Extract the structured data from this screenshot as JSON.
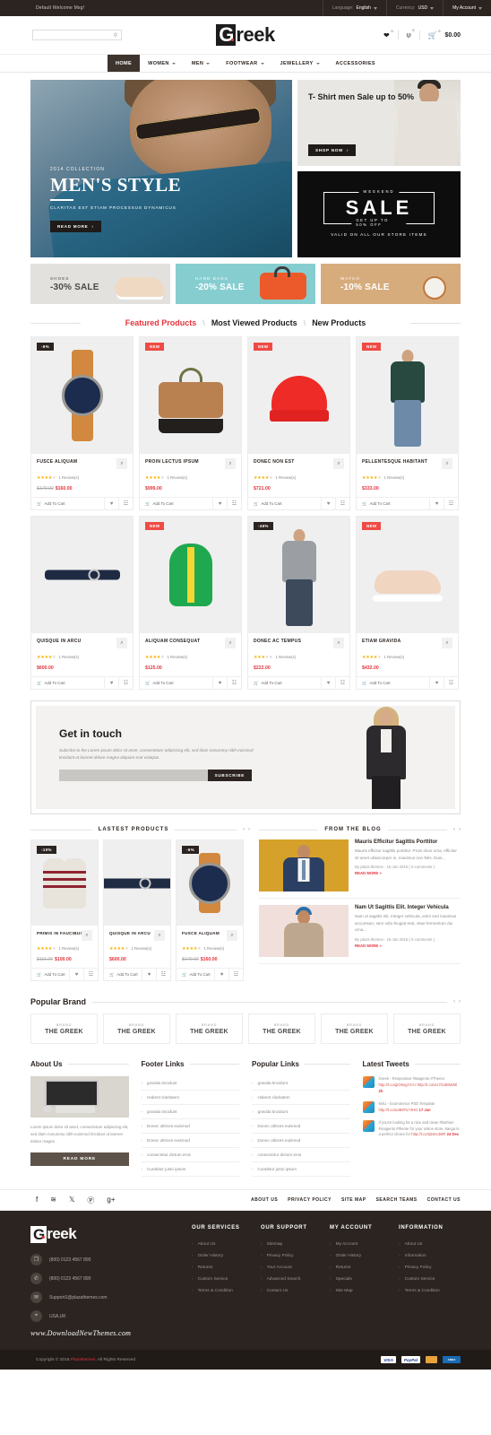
{
  "topbar": {
    "welcome": "Default Welcome Msg!",
    "language_label": "Language:",
    "language_value": "English",
    "currency_label": "Currency:",
    "currency_value": "USD",
    "account": "My Account"
  },
  "header": {
    "search_placeholder": "",
    "logo_first": "G",
    "logo_rest": "reek",
    "wishlist_count": "0",
    "compare_count": "0",
    "cart_count": "0",
    "cart_total": "$0.00"
  },
  "nav": [
    {
      "label": "HOME",
      "caret": false,
      "active": true
    },
    {
      "label": "WOMEN",
      "caret": true,
      "active": false
    },
    {
      "label": "MEN",
      "caret": true,
      "active": false
    },
    {
      "label": "FOOTWEAR",
      "caret": true,
      "active": false
    },
    {
      "label": "JEWELLERY",
      "caret": true,
      "active": false
    },
    {
      "label": "ACCESSORIES",
      "caret": false,
      "active": false
    }
  ],
  "hero": {
    "kicker": "2014 COLLECTION",
    "title": "MEN'S STYLE",
    "subtitle": "CLARITAS EST ETIAM PROCESSUS DYNAMICUS",
    "button": "READ MORE"
  },
  "promo_tshirt": {
    "title": "T- Shirt men Sale up to 50%",
    "button": "SHOP NOW"
  },
  "promo_sale": {
    "weekend": "WEEKEND",
    "big": "SALE",
    "getup": "GET UP TO 50% OFF",
    "valid": "VALID ON ALL OUR STORE ITEMS"
  },
  "categories": [
    {
      "small": "SHOES",
      "big": "-30% SALE"
    },
    {
      "small": "HAND BAGS",
      "big": "-20% SALE"
    },
    {
      "small": "WATCH",
      "big": "-10% SALE"
    }
  ],
  "tabs": [
    {
      "label": "Featured Products",
      "active": true
    },
    {
      "label": "Most Viewed Products",
      "active": false
    },
    {
      "label": "New Products",
      "active": false
    }
  ],
  "product_actions": {
    "add_to_cart": "Add To Cart",
    "review_text": "1 Review(s)"
  },
  "products": [
    {
      "name": "FUSCE ALIQUAM",
      "price": "$160.00",
      "old_price": "$170.00",
      "reviews": "1 Review(s)",
      "stars": 4,
      "badge": "-6%",
      "badge_type": "sale",
      "art": "watch"
    },
    {
      "name": "PROIN LECTUS IPSUM",
      "price": "$999.00",
      "old_price": "",
      "reviews": "1 Review(s)",
      "stars": 4,
      "badge": "NEW",
      "badge_type": "new",
      "art": "duffel"
    },
    {
      "name": "DONEC NON EST",
      "price": "$721.00",
      "old_price": "",
      "reviews": "1 Review(s)",
      "stars": 4,
      "badge": "NEW",
      "badge_type": "new",
      "art": "beanie"
    },
    {
      "name": "PELLENTESQUE HABITANT",
      "price": "$333.00",
      "old_price": "",
      "reviews": "1 Review(s)",
      "stars": 4,
      "badge": "NEW",
      "badge_type": "new",
      "art": "man-green"
    },
    {
      "name": "QUISQUE IN ARCU",
      "price": "$600.00",
      "old_price": "",
      "reviews": "1 Review(s)",
      "stars": 4,
      "badge": "",
      "badge_type": "",
      "art": "belt"
    },
    {
      "name": "ALIQUAM CONSEQUAT",
      "price": "$125.00",
      "old_price": "",
      "reviews": "1 Review(s)",
      "stars": 4,
      "badge": "NEW",
      "badge_type": "new",
      "art": "backpack"
    },
    {
      "name": "DONEC AC TEMPUS",
      "price": "$222.00",
      "old_price": "",
      "reviews": "1 Review(s)",
      "stars": 3,
      "badge": "-46%",
      "badge_type": "sale",
      "art": "man-grey"
    },
    {
      "name": "ETIAM GRAVIDA",
      "price": "$432.00",
      "old_price": "",
      "reviews": "1 Review(s)",
      "stars": 4,
      "badge": "NEW",
      "badge_type": "new",
      "art": "sneaker"
    }
  ],
  "newsletter": {
    "title": "Get in touch",
    "desc": "Subcribe to the Lorem ipsum dolor sit amet, consectetuer adipiscing elit, sed diam nonummy nibh euismod tincidunt ut laoreet dolore magna aliquam erat volutpat.",
    "input_placeholder": "",
    "button": "SUBSCRIBE"
  },
  "latest_section": {
    "title": "LASTEST PRODUCTS"
  },
  "latest_products": [
    {
      "name": "PRIMIS IN FAUCIBUS",
      "price": "$100.00",
      "old_price": "$111.00",
      "reviews": "1 Review(s)",
      "stars": 4,
      "badge": "-10%",
      "badge_type": "sale",
      "art": "gloves"
    },
    {
      "name": "QUISQUE IN ARCU",
      "price": "$600.00",
      "old_price": "",
      "reviews": "1 Review(s)",
      "stars": 4,
      "badge": "",
      "badge_type": "",
      "art": "belt"
    },
    {
      "name": "FUSCE ALIQUAM",
      "price": "$160.00",
      "old_price": "$170.00",
      "reviews": "1 Review(s)",
      "stars": 4,
      "badge": "-6%",
      "badge_type": "sale",
      "art": "watch"
    }
  ],
  "blog_section": {
    "title": "FROM THE BLOG"
  },
  "blog_posts": [
    {
      "title": "Mauris Efficitur Sagittis Porttitor",
      "excerpt": "Mauris efficitur sagittis porttitor. Proin risus urna, efficitur sit amet ullamcorper in, maximus non felis. Duis...",
      "meta": "By plaza themes - 16 Jan 2015 ( 0 comments )",
      "read_more": "READ MORE »"
    },
    {
      "title": "Nam Ut Sagittis Elit. Integer Vehicula",
      "excerpt": "Nam ut sagittis elit. Integer vehicula, enim sed maximus accumsan, sem odio feugiat erat, vitae fermentum dui urna...",
      "meta": "By plaza themes - 16 Jan 2015 ( 0 comments )",
      "read_more": "READ MORE »"
    }
  ],
  "brands_section": {
    "title": "Popular Brand"
  },
  "brands": [
    {
      "small": "BRAND",
      "big": "THE GREEK"
    },
    {
      "small": "BRAND",
      "big": "THE GREEK"
    },
    {
      "small": "BRAND",
      "big": "THE GREEK"
    },
    {
      "small": "BRAND",
      "big": "THE GREEK"
    },
    {
      "small": "BRAND",
      "big": "THE GREEK"
    },
    {
      "small": "BRAND",
      "big": "THE GREEK"
    }
  ],
  "about": {
    "title": "About Us",
    "text": "Lorem ipsum dolor sit amet, consectetuer adipiscing elit, sed diam nonummy nibh euismod tincidunt ut laoreet dolore magna",
    "button": "READ MORE"
  },
  "footer_links": {
    "title": "Footer Links",
    "items": [
      "gravida tincidunt",
      "Habent claritatem",
      "gravida tincidunt",
      "Donec ultrices euismod",
      "Donec ultrices euismod",
      "consectetur dictum eros",
      "Curabitur justo ipsum"
    ]
  },
  "popular_links": {
    "title": "Popular Links",
    "items": [
      "gravida tincidunt",
      "Habent claritatem",
      "gravida tincidunt",
      "Donec ultrices euismod",
      "Donec ultrices euismod",
      "consectetur dictum eros",
      "Curabitur justo ipsum"
    ]
  },
  "tweets": {
    "title": "Latest Tweets",
    "items": [
      {
        "text": "Greek - Responsive #Magento #Theme:",
        "link": "http://t.co/gIO6ogY4YJ",
        "link2": "http://t.co/vU7OJ88WMl",
        "time": "2h"
      },
      {
        "text": "M4U - Ecommerce PSD Template",
        "link": "http://t.co/uoB8TicYtHO",
        "link2": "",
        "time": "17 Jan"
      },
      {
        "text": "If you're looking for a nice and clean #fashion #magento #theme for your online store, kanga is a perfect choice for",
        "link": "http://t.co/tj346c36lR",
        "link2": "",
        "time": "24 Dec"
      }
    ]
  },
  "social": [
    "facebook-icon",
    "rss-icon",
    "twitter-icon",
    "pinterest-icon",
    "google-plus-icon"
  ],
  "strip_links": [
    "ABOUT US",
    "PRIVACY POLICY",
    "SITE MAP",
    "SEARCH TEAMS",
    "CONTACT US"
  ],
  "dark_footer": {
    "logo_first": "G",
    "logo_rest": "reek",
    "contacts": [
      {
        "icon": "mobile-icon",
        "text": "(800) 0123 4567 890"
      },
      {
        "icon": "phone-icon",
        "text": "(800) 0123 4567 890"
      },
      {
        "icon": "mail-icon",
        "text": "Support1@plazathemes.com"
      },
      {
        "icon": "location-icon",
        "text": "USA,UK"
      }
    ],
    "website": "www.DownloadNewThemes.com",
    "columns": [
      {
        "title": "OUR SERVICES",
        "items": [
          "About Us",
          "Order History",
          "Returns",
          "Custom Service",
          "Terms & Condition"
        ]
      },
      {
        "title": "OUR SUPPORT",
        "items": [
          "Sitemap",
          "Privacy Policy",
          "Your Account",
          "Advanced Search",
          "Contact Us"
        ]
      },
      {
        "title": "MY ACCOUNT",
        "items": [
          "My Account",
          "Order History",
          "Returns",
          "Specials",
          "Site Map"
        ]
      },
      {
        "title": "INFORMATION",
        "items": [
          "About Us",
          "Information",
          "Privacy Policy",
          "Custom Service",
          "Terms & Condition"
        ]
      }
    ]
  },
  "copyright": {
    "prefix": "Copyright © 2015 ",
    "brand": "Plazathemes",
    "suffix": ". All Rights Reserved"
  },
  "payments": [
    "VISA",
    "PayPal",
    "mastercard-icon",
    "amex-icon"
  ],
  "colors": {
    "accent": "#e5343c",
    "dark": "#2b2420",
    "star": "#f5b301"
  }
}
